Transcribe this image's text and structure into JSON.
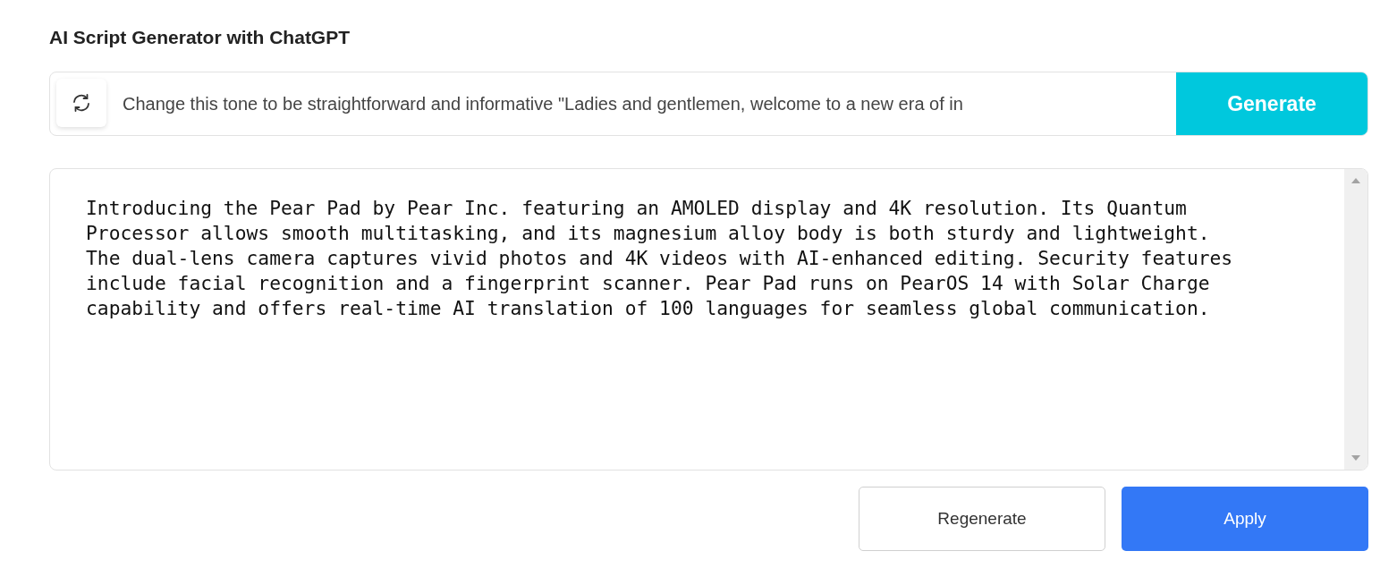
{
  "title": "AI Script Generator with ChatGPT",
  "prompt": {
    "value": "Change this tone to be straightforward and informative \"Ladies and gentlemen, welcome to a new era of in",
    "button": "Generate"
  },
  "output": {
    "text": "Introducing the Pear Pad by Pear Inc. featuring an AMOLED display and 4K resolution. Its Quantum Processor allows smooth multitasking, and its magnesium alloy body is both sturdy and lightweight. The dual-lens camera captures vivid photos and 4K videos with AI-enhanced editing. Security features include facial recognition and a fingerprint scanner. Pear Pad runs on PearOS 14 with Solar Charge capability and offers real-time AI translation of 100 languages for seamless global communication."
  },
  "actions": [
    {
      "kind": "secondary",
      "label": "Regenerate"
    },
    {
      "kind": "primary",
      "label": "Apply"
    }
  ]
}
